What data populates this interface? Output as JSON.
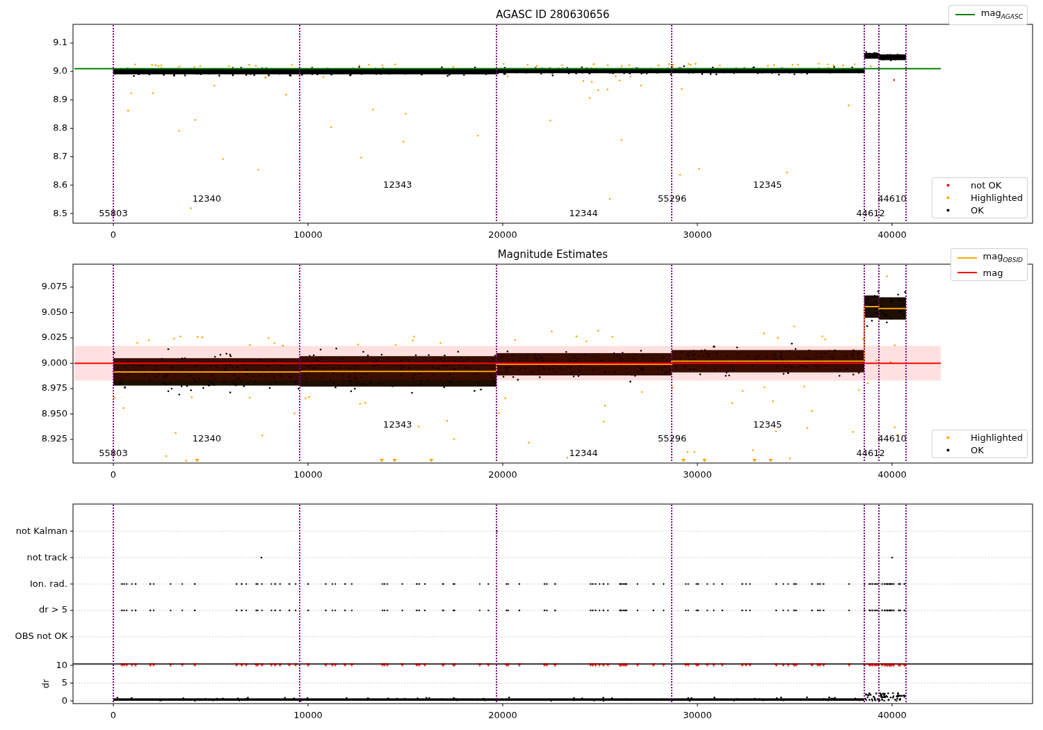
{
  "panels": [
    {
      "chart_data": {
        "type": "scatter",
        "title": "AGASC ID 280630656",
        "xlim": [
          -2071,
          47214
        ],
        "ylim": [
          8.466,
          9.166
        ],
        "xticks": [
          0,
          10000,
          20000,
          30000,
          40000
        ],
        "yticks": [
          {
            "value": 8.5,
            "label": "8.5"
          },
          {
            "value": 8.6,
            "label": "8.6"
          },
          {
            "value": 8.7,
            "label": "8.7"
          },
          {
            "value": 8.8,
            "label": "8.8"
          },
          {
            "value": 8.9,
            "label": "8.9"
          },
          {
            "value": 9.0,
            "label": "9.0"
          },
          {
            "value": 9.1,
            "label": "9.1"
          }
        ],
        "series": [
          {
            "name": "mag$_{AGASC}$",
            "type": "line",
            "color": "#008000",
            "x": [
              -2000,
              42500
            ],
            "values": [
              9.01,
              9.01
            ]
          },
          {
            "name": "not OK",
            "type": "scatter",
            "color": "#ff0000"
          },
          {
            "name": "Highlighted",
            "type": "scatter",
            "color": "#ffa500"
          },
          {
            "name": "OK",
            "type": "scatter",
            "color": "#000000"
          }
        ],
        "ref_lines": [
          {
            "axis": "x",
            "value": 0
          },
          {
            "axis": "x",
            "value": 9571
          },
          {
            "axis": "x",
            "value": 19679
          },
          {
            "axis": "x",
            "value": 28679
          },
          {
            "axis": "x",
            "value": 38571
          },
          {
            "axis": "x",
            "value": 39321
          },
          {
            "axis": "x",
            "value": 40714
          }
        ],
        "annotations": [
          "55803",
          "12340",
          "12343",
          "12344",
          "55296",
          "12345",
          "44612",
          "44610"
        ]
      }
    },
    {
      "chart_data": {
        "type": "scatter",
        "title": "Magnitude Estimates",
        "xlim": [
          -2071,
          47214
        ],
        "ylim": [
          8.9017,
          9.0976
        ],
        "xticks": [
          0,
          10000,
          20000,
          30000,
          40000
        ],
        "yticks": [
          {
            "value": 8.925,
            "label": "8.925"
          },
          {
            "value": 8.95,
            "label": "8.950"
          },
          {
            "value": 8.975,
            "label": "8.975"
          },
          {
            "value": 9.0,
            "label": "9.000"
          },
          {
            "value": 9.025,
            "label": "9.025"
          },
          {
            "value": 9.05,
            "label": "9.050"
          },
          {
            "value": 9.075,
            "label": "9.075"
          }
        ],
        "series": [
          {
            "name": "mag$_{OBSID}$",
            "type": "line",
            "color": "#ffa500",
            "x": [
              0,
              9571,
              9571,
              19679,
              19679,
              28679,
              28679,
              38571,
              38571,
              39321,
              39321,
              40714
            ],
            "values": [
              8.9915,
              8.9915,
              8.992,
              8.992,
              8.999,
              8.999,
              9.002,
              9.002,
              9.0558,
              9.0558,
              9.054,
              9.054
            ]
          },
          {
            "name": "mag",
            "type": "line",
            "color": "#ff0000",
            "x": [
              -2000,
              42500
            ],
            "values": [
              9.0,
              9.0
            ]
          },
          {
            "name": "Highlighted",
            "type": "scatter",
            "color": "#ffa500"
          },
          {
            "name": "OK",
            "type": "scatter",
            "color": "#000000"
          }
        ],
        "bands": [
          {
            "axis": "y",
            "from": 8.983,
            "to": 9.017,
            "color": "#ff0000"
          }
        ],
        "ref_lines": [
          {
            "axis": "x",
            "value": 0
          },
          {
            "axis": "x",
            "value": 9571
          },
          {
            "axis": "x",
            "value": 19679
          },
          {
            "axis": "x",
            "value": 28679
          },
          {
            "axis": "x",
            "value": 38571
          },
          {
            "axis": "x",
            "value": 39321
          },
          {
            "axis": "x",
            "value": 40714
          }
        ],
        "annotations": [
          "55803",
          "12340",
          "12343",
          "12344",
          "55296",
          "12345",
          "44612",
          "44610"
        ]
      }
    },
    {
      "chart_data": {
        "type": "scatter",
        "xlim": [
          -2071,
          47214
        ],
        "orientation": "horizontal",
        "categories": [
          "not Kalman",
          "not track",
          "Ion. rad.",
          "dr > 5",
          "OBS not OK"
        ],
        "ref_lines": [
          {
            "axis": "x",
            "value": 0
          },
          {
            "axis": "x",
            "value": 9571
          },
          {
            "axis": "x",
            "value": 19679
          },
          {
            "axis": "x",
            "value": 28679
          },
          {
            "axis": "x",
            "value": 38571
          },
          {
            "axis": "x",
            "value": 39321
          },
          {
            "axis": "x",
            "value": 40714
          }
        ]
      }
    },
    {
      "chart_data": {
        "type": "scatter",
        "ylabel": "dr",
        "xlim": [
          -2071,
          47214
        ],
        "ylim": [
          -0.78,
          10.39
        ],
        "xticks": [
          0,
          10000,
          20000,
          30000,
          40000
        ],
        "yticks": [
          {
            "value": 0,
            "label": "0"
          },
          {
            "value": 5,
            "label": "5"
          },
          {
            "value": 10,
            "label": "10"
          }
        ],
        "ref_lines": [
          {
            "axis": "x",
            "value": 0
          },
          {
            "axis": "x",
            "value": 9571
          },
          {
            "axis": "x",
            "value": 19679
          },
          {
            "axis": "x",
            "value": 28679
          },
          {
            "axis": "x",
            "value": 38571
          },
          {
            "axis": "x",
            "value": 39321
          },
          {
            "axis": "x",
            "value": 40714
          }
        ]
      }
    }
  ]
}
